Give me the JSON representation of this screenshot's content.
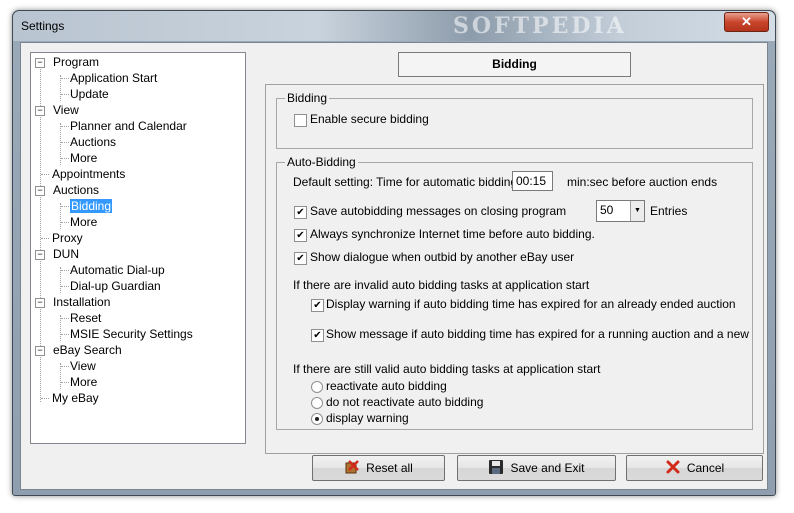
{
  "window": {
    "title": "Settings",
    "watermark": "SOFTPEDIA",
    "close_glyph": "✕"
  },
  "tree": {
    "items": [
      {
        "label": "Program",
        "expander": "−"
      },
      {
        "label": "Application Start"
      },
      {
        "label": "Update"
      },
      {
        "label": "View",
        "expander": "−"
      },
      {
        "label": "Planner and Calendar"
      },
      {
        "label": "Auctions"
      },
      {
        "label": "More"
      },
      {
        "label": "Appointments"
      },
      {
        "label": "Auctions",
        "expander": "−"
      },
      {
        "label": "Bidding",
        "selected": true
      },
      {
        "label": "More"
      },
      {
        "label": "Proxy"
      },
      {
        "label": "DUN",
        "expander": "−"
      },
      {
        "label": "Automatic Dial-up"
      },
      {
        "label": "Dial-up Guardian"
      },
      {
        "label": "Installation",
        "expander": "−"
      },
      {
        "label": "Reset"
      },
      {
        "label": "MSIE Security Settings"
      },
      {
        "label": "eBay Search",
        "expander": "−"
      },
      {
        "label": "View"
      },
      {
        "label": "More"
      },
      {
        "label": "My eBay"
      }
    ]
  },
  "header": {
    "title": "Bidding"
  },
  "bidding_group": {
    "legend": "Bidding",
    "secure_label": "Enable secure bidding",
    "secure_checked": false
  },
  "auto_group": {
    "legend": "Auto-Bidding",
    "default_label": "Default setting: Time for automatic bidding",
    "time_value": "00:15",
    "time_suffix": "min:sec before auction ends",
    "save_label": "Save autobidding messages on closing program",
    "save_checked": true,
    "entries_value": "50",
    "entries_label": "Entries",
    "sync_label": "Always synchronize Internet time before auto bidding.",
    "sync_checked": true,
    "dialog_label": "Show dialogue when outbid by another eBay user",
    "dialog_checked": true,
    "invalid_heading": "If there are invalid auto bidding tasks at application start",
    "warn_ended_label": "Display warning if auto bidding time has expired for an already ended auction",
    "warn_ended_checked": true,
    "warn_running_label": "Show message if auto bidding time has expired for a running auction and a new auto biddir",
    "warn_running_checked": true,
    "valid_heading": "If there are still valid auto bidding tasks at application start",
    "radio_options": [
      "reactivate auto bidding",
      "do not reactivate auto bidding",
      "display warning"
    ],
    "radio_selected": "display warning"
  },
  "buttons": {
    "reset": "Reset all",
    "save": "Save and Exit",
    "cancel": "Cancel"
  },
  "icons": {
    "reset": "reset-icon",
    "save": "floppy-disk-icon",
    "cancel": "red-x-icon"
  },
  "colors": {
    "selection": "#3399ff",
    "cancel_x": "#d12a1a"
  }
}
